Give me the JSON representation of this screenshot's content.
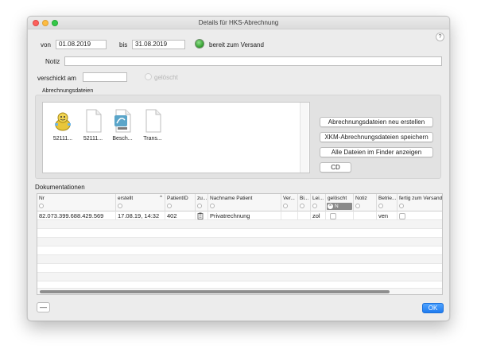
{
  "window": {
    "title": "Details für HKS-Abrechnung"
  },
  "help": {
    "label": "?"
  },
  "form": {
    "von_label": "von",
    "von_value": "01.08.2019",
    "bis_label": "bis",
    "bis_value": "31.08.2019",
    "status_label": "bereit zum Versand",
    "notiz_label": "Notiz",
    "notiz_value": "",
    "verschickt_label": "verschickt am",
    "verschickt_value": "",
    "geloescht_label": "gelöscht"
  },
  "files": {
    "group_title": "Abrechnungsdateien",
    "items": [
      {
        "name": "52111...",
        "icon": "app-icon"
      },
      {
        "name": "52111...",
        "icon": "document-icon"
      },
      {
        "name": "Besch...",
        "icon": "text-document-icon"
      },
      {
        "name": "Trans...",
        "icon": "document-icon"
      }
    ]
  },
  "buttons": {
    "recreate": "Abrechnungsdateien neu erstellen",
    "save_xkm": "XKM-Abrechnungsdateien speichern",
    "show_finder": "Alle Dateien im Finder anzeigen",
    "cd": "CD",
    "minus": "—",
    "ok": "OK"
  },
  "docs": {
    "title": "Dokumentationen",
    "columns": [
      "Nr",
      "erstellt",
      "PatientID",
      "zu...",
      "Nachname Patient",
      "Ver...",
      "Bi...",
      "Lei...",
      "gelöscht",
      "Notiz",
      "Betrie...",
      "fertig zum Versand"
    ],
    "geloescht_filter": "N",
    "rows": [
      {
        "nr": "82.073.399.688.429.569",
        "erstellt": "17.08.19, 14:32",
        "patient_id": "402",
        "zu": "clipboard-icon",
        "nachname": "Privatrechnung",
        "ver": "",
        "bi": "",
        "lei": "zol",
        "notiz": "",
        "betrieb": "ven"
      }
    ]
  },
  "colors": {
    "accent": "#1f7bef",
    "status_green": "#2f9b2b"
  }
}
